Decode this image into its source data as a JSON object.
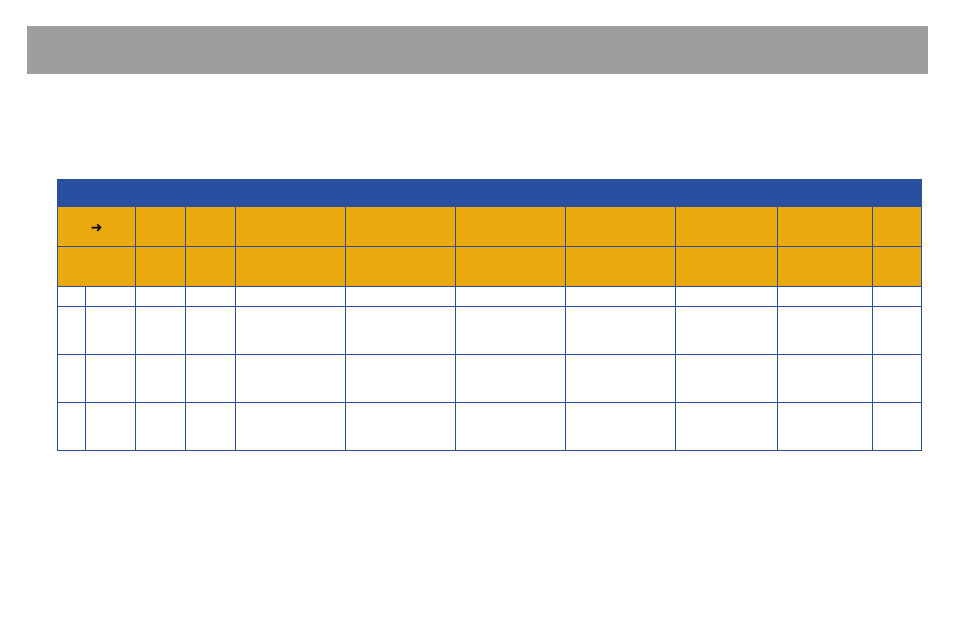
{
  "banner": {
    "title": ""
  },
  "table": {
    "top_band_label": "",
    "header_row_a": {
      "arrow": "➜",
      "col2": "",
      "col2b": "",
      "col3": "",
      "col4": "",
      "col5": "",
      "col6": "",
      "col7": "",
      "col8": "",
      "col9": ""
    },
    "header_row_b": {
      "col1": "",
      "col2": "",
      "col2b": "",
      "col3": "",
      "col4": "",
      "col5": "",
      "col6": "",
      "col7": "",
      "col8": "",
      "col9": ""
    },
    "rows": [
      {
        "c0": "",
        "c1": "",
        "c2": "",
        "c2b": "",
        "c3": "",
        "c4": "",
        "c5": "",
        "c6": "",
        "c7": "",
        "c8": "",
        "c9": ""
      },
      {
        "c0": "",
        "c1": "",
        "c2": "",
        "c2b": "",
        "c3": "",
        "c4": "",
        "c5": "",
        "c6": "",
        "c7": "",
        "c8": "",
        "c9": ""
      },
      {
        "c0": "",
        "c1": "",
        "c2": "",
        "c2b": "",
        "c3": "",
        "c4": "",
        "c5": "",
        "c6": "",
        "c7": "",
        "c8": "",
        "c9": ""
      },
      {
        "c0": "",
        "c1": "",
        "c2": "",
        "c2b": "",
        "c3": "",
        "c4": "",
        "c5": "",
        "c6": "",
        "c7": "",
        "c8": "",
        "c9": ""
      }
    ]
  }
}
